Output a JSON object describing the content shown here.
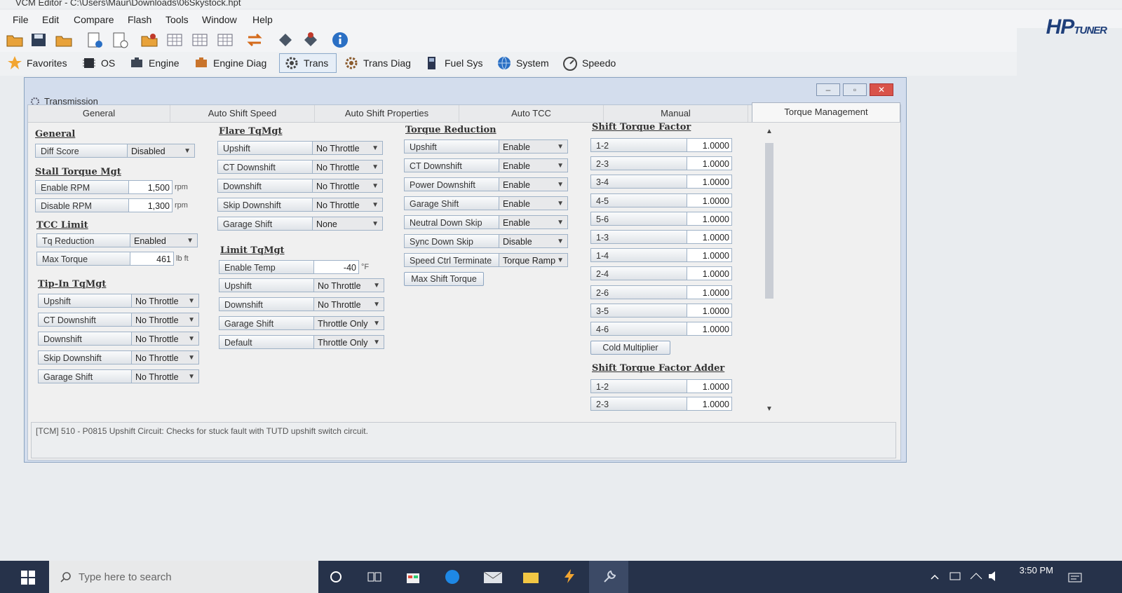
{
  "app": {
    "title": "VCM Editor - C:\\Users\\Maur\\Downloads\\06Skystock.hpt"
  },
  "menu": [
    "File",
    "Edit",
    "Compare",
    "Flash",
    "Tools",
    "Window",
    "Help"
  ],
  "brand": {
    "logo": "HP",
    "logo_sub": "TUNER",
    "color": "#1f3f7a"
  },
  "nav": [
    {
      "label": "Favorites",
      "icon": "star-icon"
    },
    {
      "label": "OS",
      "icon": "chip-icon"
    },
    {
      "label": "Engine",
      "icon": "engine-icon"
    },
    {
      "label": "Engine Diag",
      "icon": "engine-diag-icon"
    },
    {
      "label": "Trans",
      "icon": "gear-icon",
      "active": true
    },
    {
      "label": "Trans Diag",
      "icon": "gear-diag-icon"
    },
    {
      "label": "Fuel Sys",
      "icon": "fuel-pump-icon"
    },
    {
      "label": "System",
      "icon": "globe-icon"
    },
    {
      "label": "Speedo",
      "icon": "speedometer-icon"
    }
  ],
  "window": {
    "title": "Transmission"
  },
  "tabs": [
    "General",
    "Auto Shift Speed",
    "Auto Shift Properties",
    "Auto TCC",
    "Manual",
    "Torque Management"
  ],
  "active_tab": "Torque Management",
  "general": {
    "header": "General",
    "diff_score": {
      "label": "Diff Score",
      "value": "Disabled"
    },
    "stall_header": "Stall Torque Mgt",
    "enable_rpm": {
      "label": "Enable RPM",
      "value": "1,500",
      "unit": "rpm"
    },
    "disable_rpm": {
      "label": "Disable RPM",
      "value": "1,300",
      "unit": "rpm"
    },
    "tcc_header": "TCC Limit",
    "tq_reduction": {
      "label": "Tq Reduction",
      "value": "Enabled"
    },
    "max_torque": {
      "label": "Max Torque",
      "value": "461",
      "unit": "lb ft"
    },
    "tipin_header": "Tip-In TqMgt",
    "tipin": [
      {
        "label": "Upshift",
        "value": "No Throttle"
      },
      {
        "label": "CT Downshift",
        "value": "No Throttle"
      },
      {
        "label": "Downshift",
        "value": "No Throttle"
      },
      {
        "label": "Skip Downshift",
        "value": "No Throttle"
      },
      {
        "label": "Garage Shift",
        "value": "No Throttle"
      }
    ]
  },
  "flare": {
    "header": "Flare TqMgt",
    "items": [
      {
        "label": "Upshift",
        "value": "No Throttle"
      },
      {
        "label": "CT Downshift",
        "value": "No Throttle"
      },
      {
        "label": "Downshift",
        "value": "No Throttle"
      },
      {
        "label": "Skip Downshift",
        "value": "No Throttle"
      },
      {
        "label": "Garage Shift",
        "value": "None"
      }
    ]
  },
  "limit": {
    "header": "Limit TqMgt",
    "enable_temp": {
      "label": "Enable Temp",
      "value": "-40",
      "unit": "°F"
    },
    "items": [
      {
        "label": "Upshift",
        "value": "No Throttle"
      },
      {
        "label": "Downshift",
        "value": "No Throttle"
      },
      {
        "label": "Garage Shift",
        "value": "Throttle Only"
      },
      {
        "label": "Default",
        "value": "Throttle Only"
      }
    ]
  },
  "torque_reduction": {
    "header": "Torque Reduction",
    "items": [
      {
        "label": "Upshift",
        "value": "Enable"
      },
      {
        "label": "CT Downshift",
        "value": "Enable"
      },
      {
        "label": "Power Downshift",
        "value": "Enable"
      },
      {
        "label": "Garage Shift",
        "value": "Enable"
      },
      {
        "label": "Neutral Down Skip",
        "value": "Enable"
      },
      {
        "label": "Sync Down Skip",
        "value": "Disable"
      },
      {
        "label": "Speed Ctrl Terminate",
        "value": "Torque Ramp"
      }
    ],
    "max_shift_torque_button": "Max Shift Torque"
  },
  "shift_torque_factor": {
    "header": "Shift Torque Factor",
    "items": [
      {
        "label": "1-2",
        "value": "1.0000"
      },
      {
        "label": "2-3",
        "value": "1.0000"
      },
      {
        "label": "3-4",
        "value": "1.0000"
      },
      {
        "label": "4-5",
        "value": "1.0000"
      },
      {
        "label": "5-6",
        "value": "1.0000"
      },
      {
        "label": "1-3",
        "value": "1.0000"
      },
      {
        "label": "1-4",
        "value": "1.0000"
      },
      {
        "label": "2-4",
        "value": "1.0000"
      },
      {
        "label": "2-6",
        "value": "1.0000"
      },
      {
        "label": "3-5",
        "value": "1.0000"
      },
      {
        "label": "4-6",
        "value": "1.0000"
      }
    ],
    "cold_multiplier_button": "Cold Multiplier"
  },
  "shift_torque_factor_adder": {
    "header": "Shift Torque Factor Adder",
    "items": [
      {
        "label": "1-2",
        "value": "1.0000"
      },
      {
        "label": "2-3",
        "value": "1.0000"
      }
    ]
  },
  "status": {
    "text": "[TCM] 510 - P0815 Upshift Circuit: Checks for stuck fault with TUTD upshift switch circuit."
  },
  "taskbar": {
    "search_placeholder": "Type here to search",
    "clock": "3:50 PM"
  }
}
